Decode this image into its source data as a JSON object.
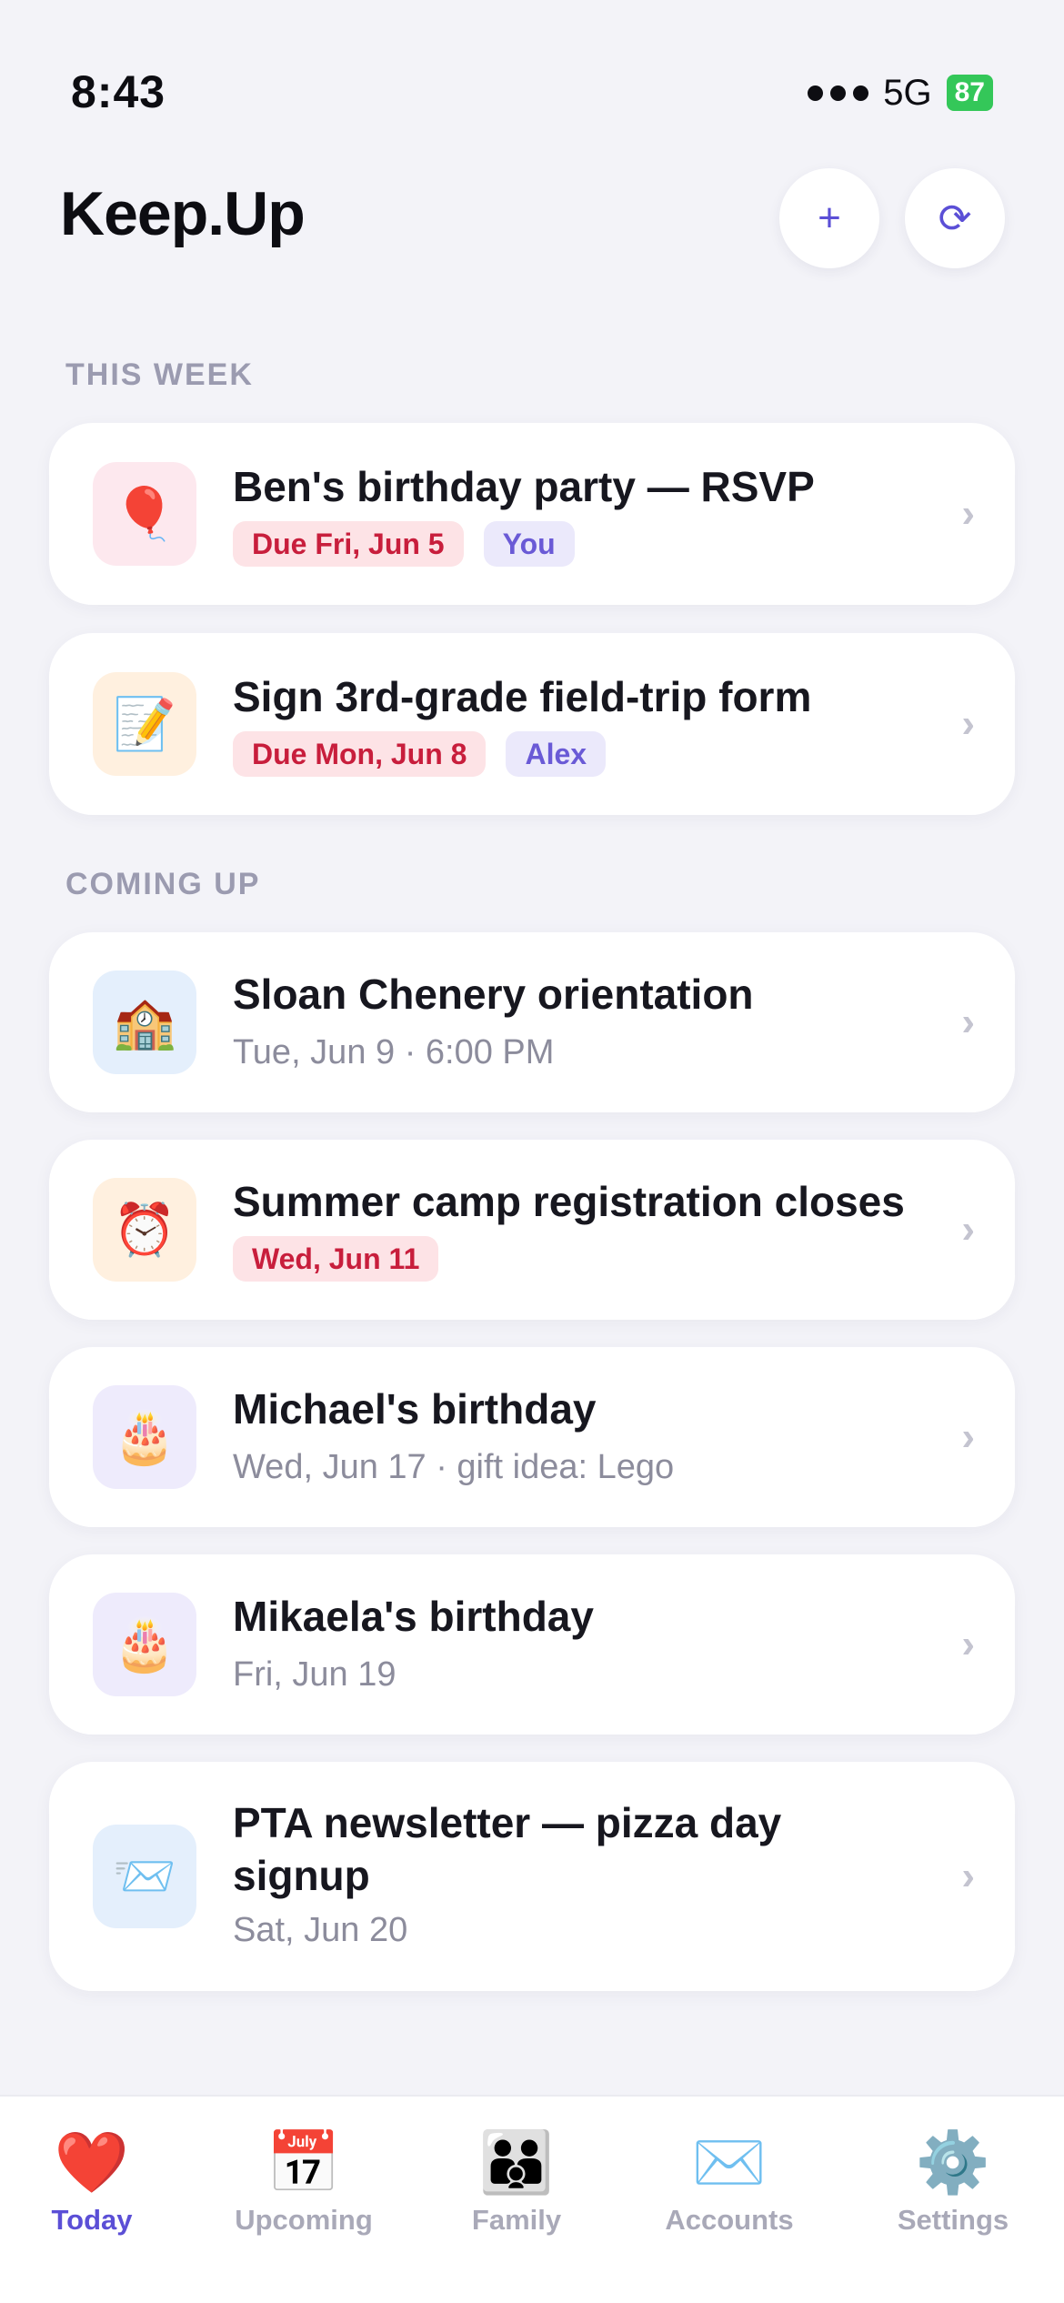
{
  "status_bar": {
    "time": "8:43",
    "network": "5G",
    "battery": "87"
  },
  "header": {
    "title": "Keep.Up",
    "add_label": "+",
    "refresh_label": "⟳"
  },
  "sections": {
    "this_week": "THIS WEEK",
    "coming_up": "COMING UP"
  },
  "this_week_items": [
    {
      "icon": "balloon-icon",
      "emoji": "🎈",
      "title": "Ben's birthday party — RSVP",
      "due": "Due Fri, Jun 5",
      "assignee": "You"
    },
    {
      "icon": "memo-icon",
      "emoji": "📝",
      "title": "Sign 3rd-grade field-trip form",
      "due": "Due Mon, Jun 8",
      "assignee": "Alex"
    }
  ],
  "coming_up_items": [
    {
      "icon": "school-icon",
      "emoji": "🏫",
      "title": "Sloan Chenery orientation",
      "subtitle": "Tue, Jun 9 · 6:00 PM"
    },
    {
      "icon": "alarm-clock-icon",
      "emoji": "⏰",
      "title": "Summer camp registration closes",
      "due": "Wed, Jun 11"
    },
    {
      "icon": "birthday-cake-icon",
      "emoji": "🎂",
      "title": "Michael's birthday",
      "subtitle": "Wed, Jun 17 · gift idea: Lego"
    },
    {
      "icon": "birthday-cake-icon",
      "emoji": "🎂",
      "title": "Mikaela's birthday",
      "subtitle": "Fri, Jun 19"
    },
    {
      "icon": "envelope-icon",
      "emoji": "📨",
      "title": "PTA newsletter — pizza day signup",
      "subtitle": "Sat, Jun 20"
    }
  ],
  "tab_bar": [
    {
      "icon": "heart-icon",
      "emoji": "❤️",
      "label": "Today",
      "active": true
    },
    {
      "icon": "calendar-icon",
      "emoji": "📅",
      "label": "Upcoming",
      "active": false
    },
    {
      "icon": "family-icon",
      "emoji": "👪",
      "label": "Family",
      "active": false
    },
    {
      "icon": "mail-icon",
      "emoji": "✉️",
      "label": "Accounts",
      "active": false
    },
    {
      "icon": "gear-icon",
      "emoji": "⚙️",
      "label": "Settings",
      "active": false
    }
  ],
  "colors": {
    "accent": "#5b4fd6",
    "due_text": "#c81e3c",
    "due_bg": "#fde3e6",
    "background": "#f3f3f8"
  }
}
